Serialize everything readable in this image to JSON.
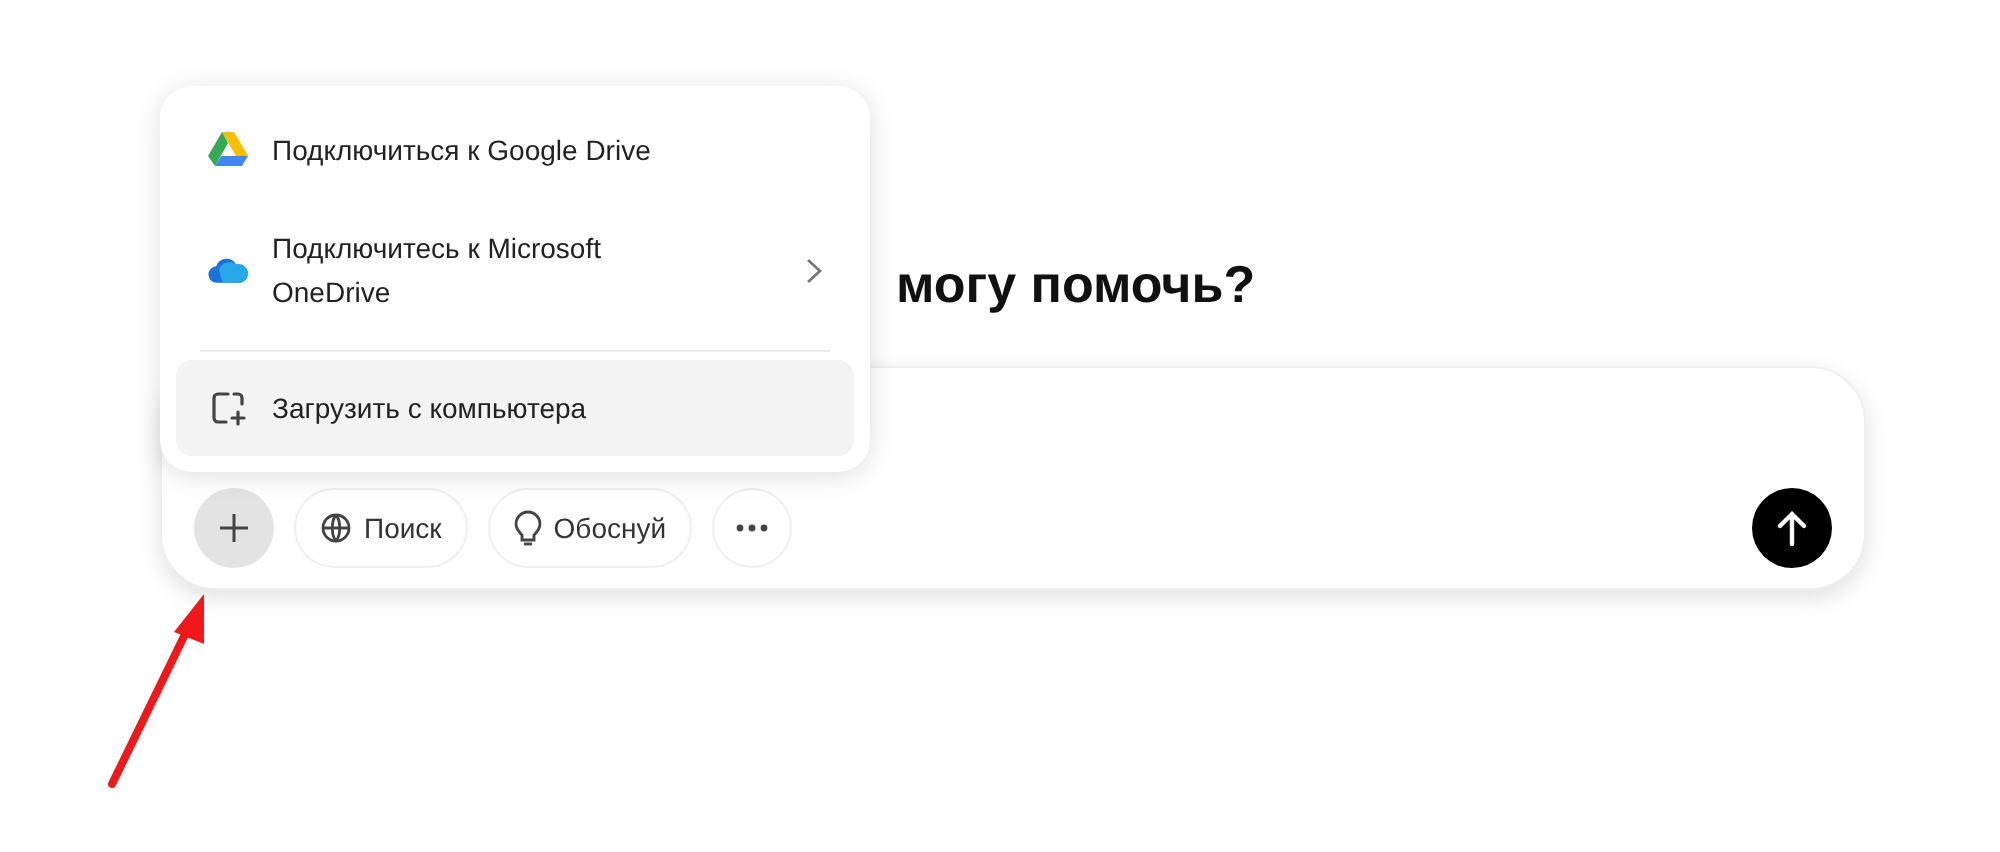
{
  "heading": "могу помочь?",
  "menu": {
    "items": [
      {
        "kind": "google-drive",
        "label": "Подключиться к Google Drive",
        "has_submenu": false,
        "selected": false
      },
      {
        "kind": "onedrive",
        "label": "Подключитесь к Microsoft OneDrive",
        "has_submenu": true,
        "selected": false
      },
      {
        "kind": "upload",
        "label": "Загрузить с компьютера",
        "has_submenu": false,
        "selected": true
      }
    ]
  },
  "composer": {
    "tools": [
      {
        "kind": "attach",
        "selected": true
      },
      {
        "kind": "search",
        "label": "Поиск",
        "selected": false
      },
      {
        "kind": "reason",
        "label": "Обоснуй",
        "selected": false
      },
      {
        "kind": "more",
        "selected": false
      }
    ]
  },
  "annotation": {
    "kind": "arrow"
  }
}
